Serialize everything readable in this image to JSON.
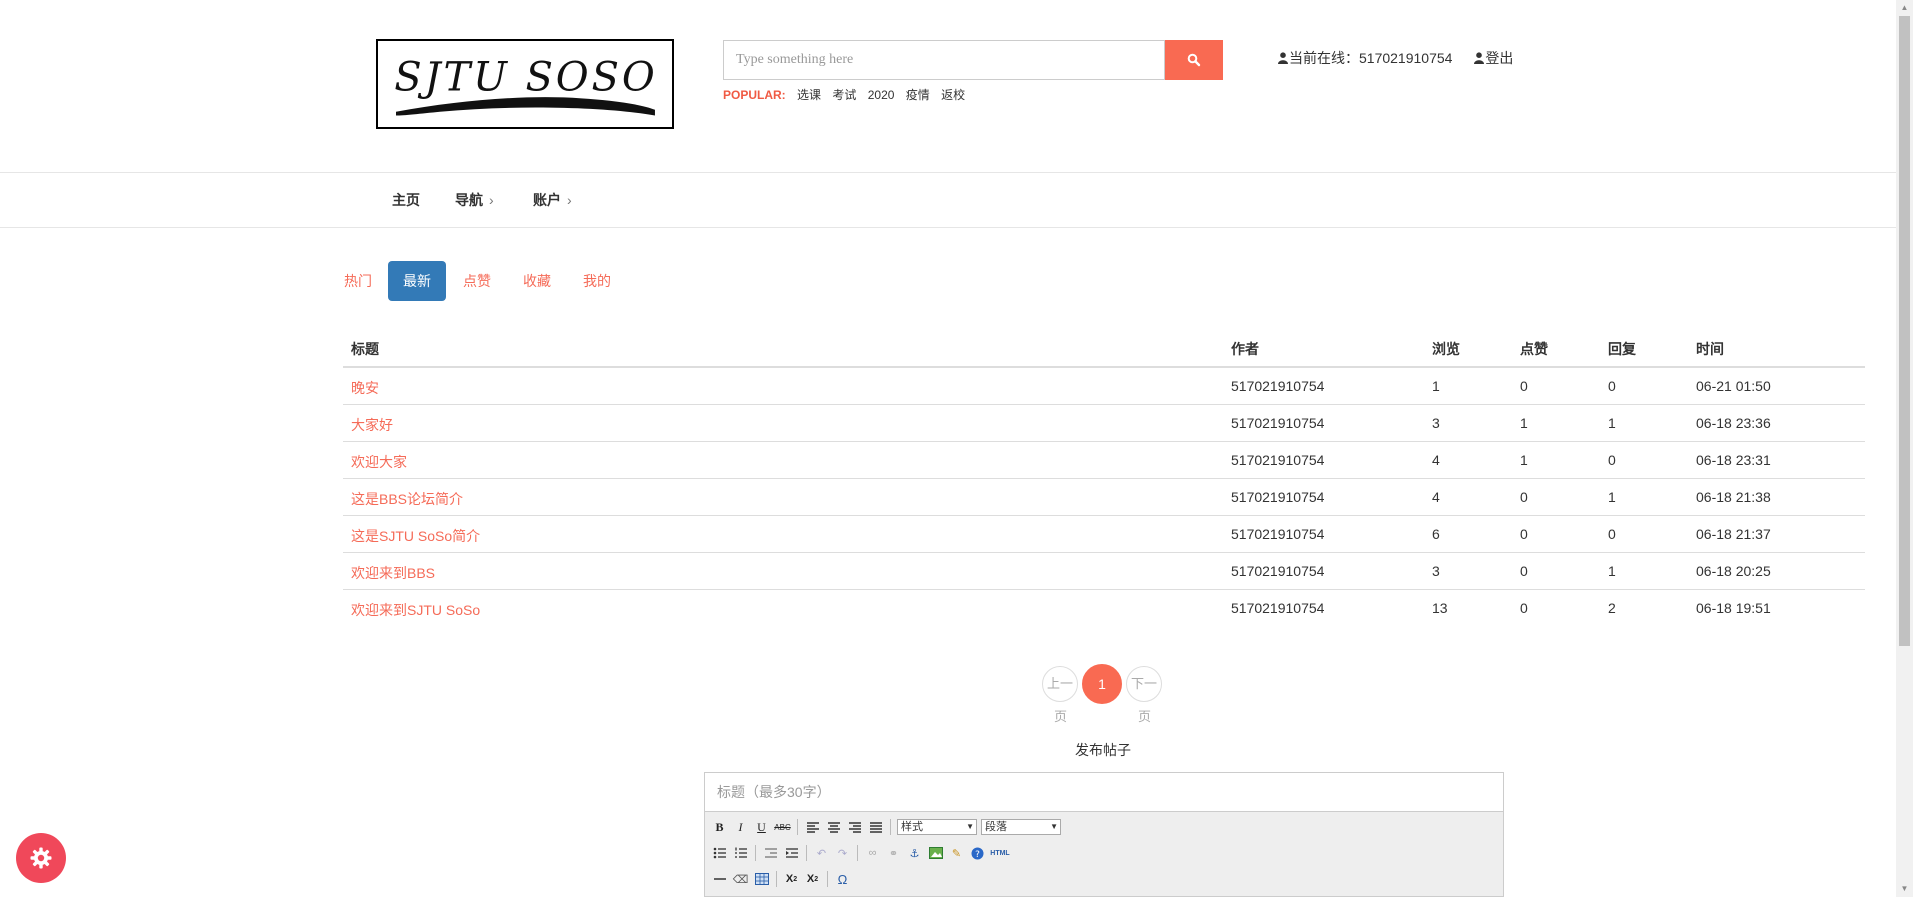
{
  "header": {
    "logo_text": "SJTU SOSO",
    "search": {
      "placeholder": "Type something here"
    },
    "popular": {
      "label": "POPULAR:",
      "tags": [
        "选课",
        "考试",
        "2020",
        "疫情",
        "返校"
      ]
    },
    "user": {
      "online_label": "当前在线：",
      "user_id": "517021910754",
      "logout_label": "登出"
    }
  },
  "nav": {
    "items": [
      "主页",
      "导航",
      "账户"
    ]
  },
  "tabs": [
    "热门",
    "最新",
    "点赞",
    "收藏",
    "我的"
  ],
  "active_tab": "最新",
  "table": {
    "headers": [
      "标题",
      "作者",
      "浏览",
      "点赞",
      "回复",
      "时间"
    ],
    "rows": [
      [
        "晚安",
        "517021910754",
        "1",
        "0",
        "0",
        "06-21 01:50"
      ],
      [
        "大家好",
        "517021910754",
        "3",
        "1",
        "1",
        "06-18 23:36"
      ],
      [
        "欢迎大家",
        "517021910754",
        "4",
        "1",
        "0",
        "06-18 23:31"
      ],
      [
        "这是BBS论坛简介",
        "517021910754",
        "4",
        "0",
        "1",
        "06-18 21:38"
      ],
      [
        "这是SJTU SoSo简介",
        "517021910754",
        "6",
        "0",
        "0",
        "06-18 21:37"
      ],
      [
        "欢迎来到BBS",
        "517021910754",
        "3",
        "0",
        "1",
        "06-18 20:25"
      ],
      [
        "欢迎来到SJTU SoSo",
        "517021910754",
        "13",
        "0",
        "2",
        "06-18 19:51"
      ]
    ]
  },
  "pagination": {
    "prev_top": "上一",
    "prev_bottom": "页",
    "current": "1",
    "next_top": "下一",
    "next_bottom": "页"
  },
  "compose": {
    "heading": "发布帖子",
    "title_placeholder": "标题（最多30字）",
    "style_select": "样式",
    "paragraph_select": "段落"
  },
  "colors": {
    "accent": "#f96a52",
    "link": "#f56b58",
    "active_tab": "#337ab7",
    "fab": "#f0485a"
  }
}
